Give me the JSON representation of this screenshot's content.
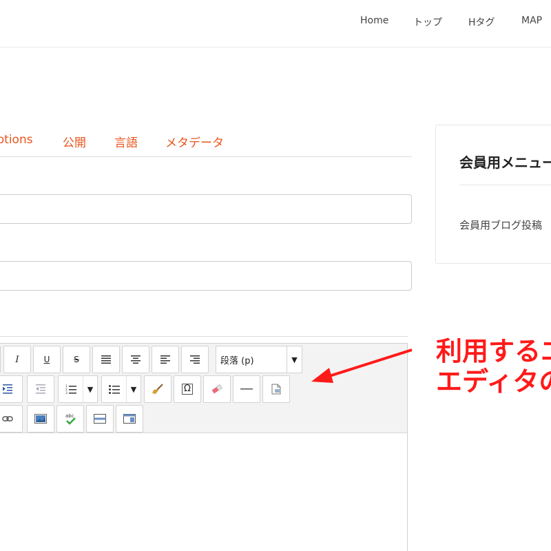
{
  "header": {
    "nav": [
      {
        "label": "Home"
      },
      {
        "label": "トップ"
      },
      {
        "label": "Hタグ"
      },
      {
        "label": "MAP"
      }
    ]
  },
  "tabs": [
    {
      "label": "Options"
    },
    {
      "label": "公開"
    },
    {
      "label": "言語"
    },
    {
      "label": "メタデータ"
    }
  ],
  "inputs": [
    {
      "value": ""
    },
    {
      "value": ""
    }
  ],
  "editor": {
    "buttons": {
      "italic": "I",
      "underline": "U",
      "strikethrough": "S",
      "special_char": "Ω"
    },
    "format_select": "段落 (p)",
    "dropdown_arrow": "▼"
  },
  "sidebar": {
    "title": "会員用メニュー",
    "link": "会員用ブログ投稿"
  },
  "annotation": {
    "line1": "利用するエ",
    "line2": "エディタの"
  },
  "colors": {
    "accent": "#e8551d",
    "annotation": "#ff1a1a"
  }
}
